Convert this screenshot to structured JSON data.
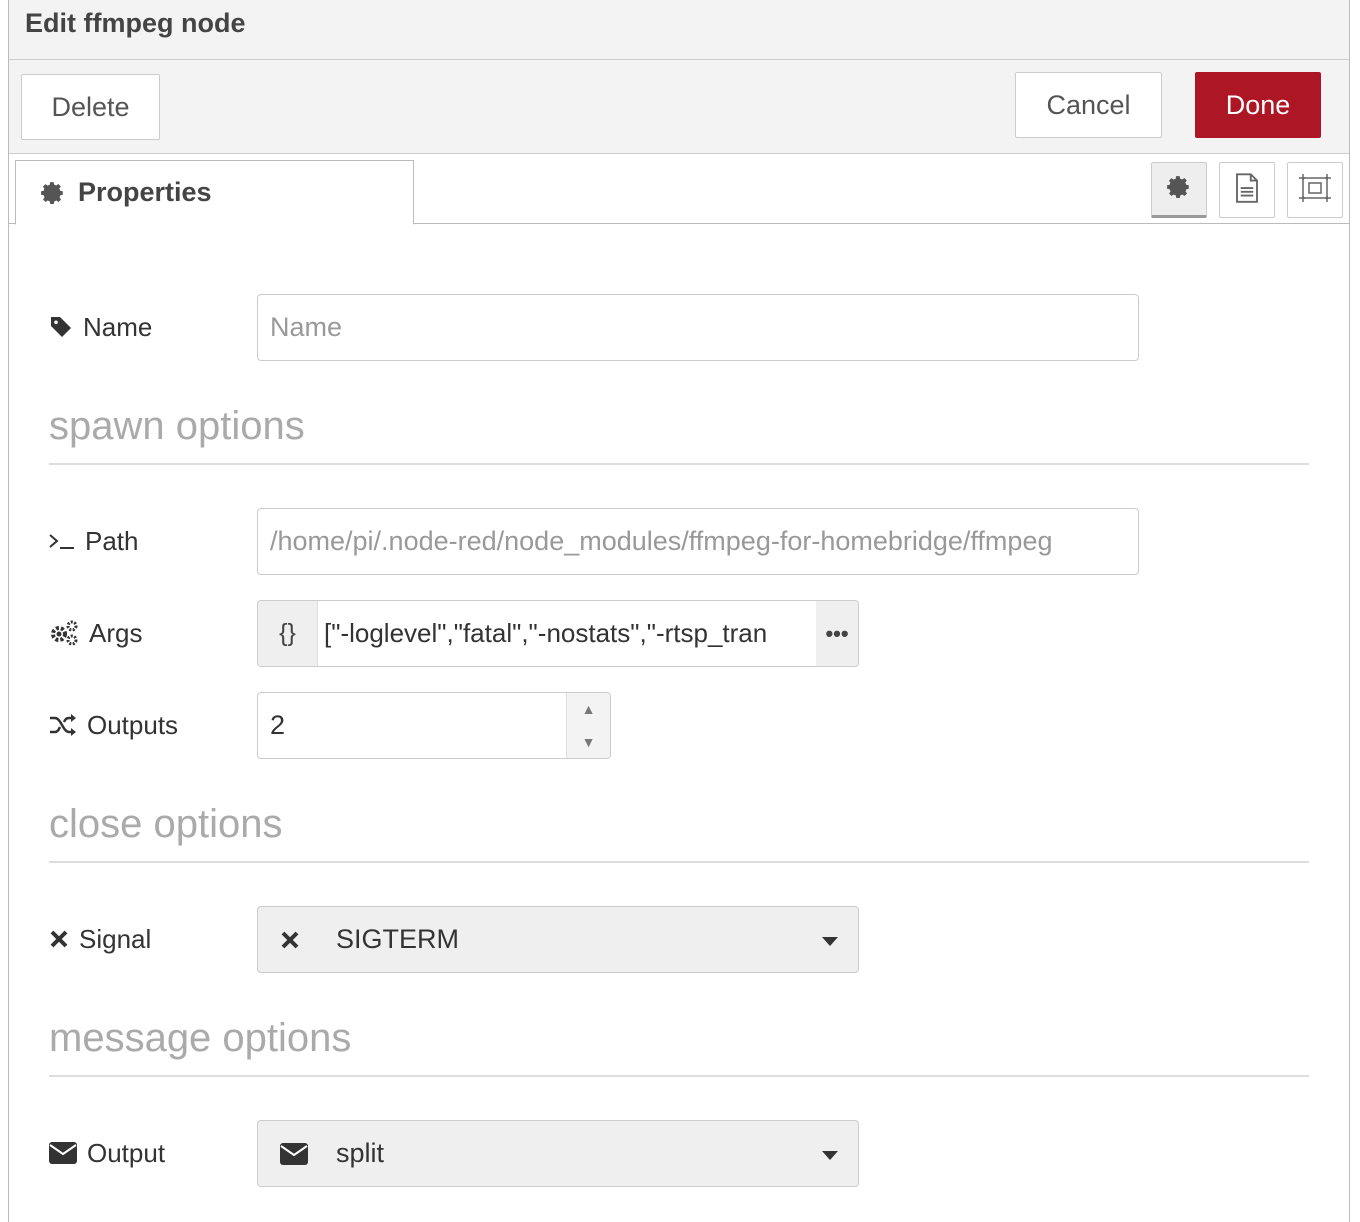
{
  "tray": {
    "title": "Edit ffmpeg node",
    "delete_label": "Delete",
    "cancel_label": "Cancel",
    "done_label": "Done",
    "done_color": "#ad1625"
  },
  "tabs": {
    "properties_label": "Properties",
    "icons": [
      "gear-icon",
      "description-icon",
      "appearance-icon"
    ]
  },
  "form": {
    "name_label": "Name",
    "name_placeholder": "Name",
    "name_value": "",
    "spawn_title": "spawn options",
    "path_label": "Path",
    "path_value": "/home/pi/.node-red/node_modules/ffmpeg-for-homebridge/ffmpeg",
    "args_label": "Args",
    "args_type": "{}",
    "args_value": "[\"-loglevel\",\"fatal\",\"-nostats\",\"-rtsp_tran",
    "args_expand": "•••",
    "outputs_label": "Outputs",
    "outputs_value": "2",
    "close_title": "close options",
    "signal_label": "Signal",
    "signal_value": "SIGTERM",
    "message_title": "message options",
    "output_label": "Output",
    "output_value": "split"
  }
}
